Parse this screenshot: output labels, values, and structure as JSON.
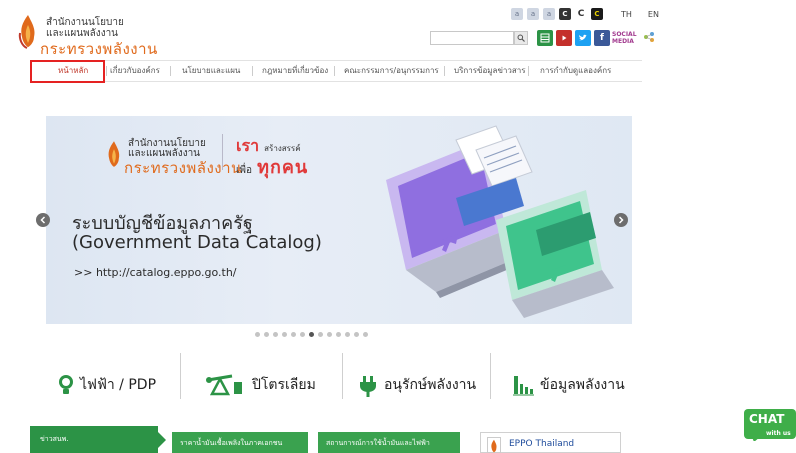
{
  "header": {
    "logo_line1": "สำนักงานนโยบาย",
    "logo_line2": "และแผนพลังงาน",
    "logo_line3": "กระทรวงพลังงาน",
    "accessibility": [
      "a",
      "a",
      "a",
      "C",
      "C",
      "C"
    ],
    "lang_th": "TH",
    "lang_en": "EN",
    "search_placeholder": "",
    "social_text_line1": "SOCIAL",
    "social_text_line2": "MEDIA",
    "colors": {
      "brand_orange": "#e06a1c",
      "green": "#2c9346",
      "highlight": "#e52222"
    }
  },
  "nav": {
    "items": [
      "หน้าหลัก",
      "เกี่ยวกับองค์กร",
      "นโยบายและแผน",
      "กฎหมายที่เกี่ยวข้อง",
      "คณะกรรมการ/อนุกรรมการ",
      "บริการข้อมูลข่าวสาร",
      "การกำกับดูแลองค์กร"
    ],
    "active_index": 0
  },
  "slider": {
    "logo_line1": "สำนักงานนโยบาย",
    "logo_line2": "และแผนพลังงาน",
    "logo_line3": "กระทรวงพลังงาน",
    "slogan_a": "เรา",
    "slogan_b": "สร้างสรรค์",
    "slogan_c": "เพื่อ",
    "slogan_d": "ทุกคน",
    "title": "ระบบบัญชีข้อมูลภาครัฐ",
    "subtitle": "(Government Data Catalog)",
    "url_prefix": ">>",
    "url": "http://catalog.eppo.go.th/",
    "dots_total": 13,
    "dots_active": 6
  },
  "categories": [
    {
      "label": "ไฟฟ้า / PDP",
      "icon": "lightbulb-icon"
    },
    {
      "label": "ปิโตรเลียม",
      "icon": "oil-pump-icon"
    },
    {
      "label": "อนุรักษ์พลังงาน",
      "icon": "plug-icon"
    },
    {
      "label": "ข้อมูลพลังงาน",
      "icon": "bar-chart-icon"
    }
  ],
  "bottom": {
    "news_label": "ข่าวสนพ.",
    "tab1": "ราคาน้ำมันเชื้อเพลิงในภาคเอกชน",
    "tab2": "สถานการณ์การใช้น้ำมันและไฟฟ้า",
    "eppo_name": "EPPO Thailand"
  },
  "chat": {
    "line1": "CHAT",
    "line2": "with us"
  }
}
